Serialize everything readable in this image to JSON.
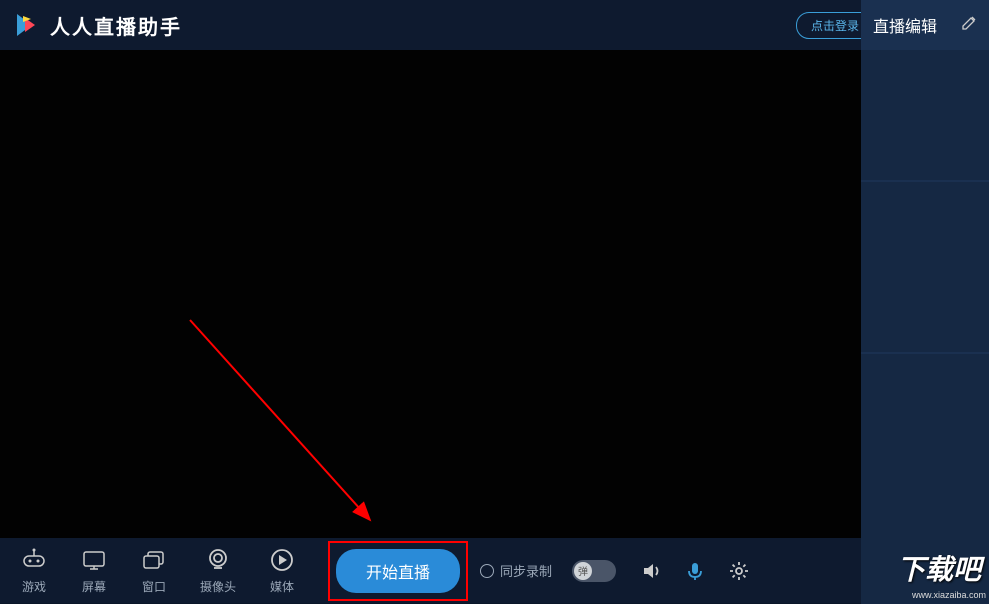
{
  "app": {
    "title": "人人直播助手"
  },
  "titlebar": {
    "login_label": "点击登录"
  },
  "sidebar": {
    "header": "直播编辑"
  },
  "toolbar": {
    "items": [
      {
        "label": "游戏"
      },
      {
        "label": "屏幕"
      },
      {
        "label": "窗口"
      },
      {
        "label": "摄像头"
      },
      {
        "label": "媒体"
      }
    ],
    "start_label": "开始直播",
    "sync_record_label": "同步录制",
    "toggle_label": "弹"
  },
  "watermark": {
    "text": "下载吧",
    "url": "www.xiazaiba.com"
  }
}
